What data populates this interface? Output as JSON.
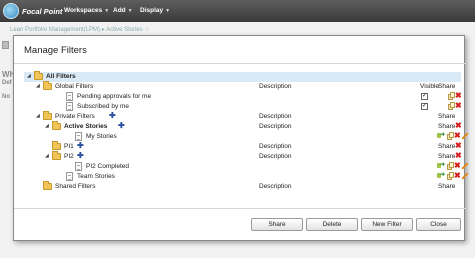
{
  "app": {
    "name": "Focal Point",
    "menus": [
      "Workspaces",
      "Add",
      "Display"
    ],
    "breadcrumb_path": "Lean Portfolio Management(LPM)",
    "breadcrumb_current": "Active Stories",
    "bg_labels": [
      "Wh",
      "Def",
      "No"
    ]
  },
  "modal": {
    "title": "Manage Filters",
    "columns": {
      "description": "Description",
      "visible": "Visible",
      "share": "Share"
    },
    "buttons": {
      "share": "Share",
      "delete": "Delete",
      "new_filter": "New Filter",
      "close": "Close"
    },
    "tree": [
      {
        "label": "All Filters",
        "level": 0,
        "kind": "folder",
        "bold": true,
        "selected": true,
        "expander": "down"
      },
      {
        "label": "Global Filters",
        "level": 1,
        "kind": "folder",
        "bold": false,
        "expander": "down",
        "description_header": true,
        "visible_header": true,
        "share_header": true
      },
      {
        "label": "Pending approvals for me",
        "level": 2,
        "kind": "doc",
        "visible_checked": true,
        "share_icons": [
          "copy",
          "delete"
        ]
      },
      {
        "label": "Subscribed by me",
        "level": 2,
        "kind": "doc",
        "visible_checked": true,
        "share_icons": [
          "copy",
          "delete"
        ]
      },
      {
        "label": "Private Filters",
        "level": 1,
        "kind": "folder",
        "expander": "down",
        "add": true,
        "description_header": true,
        "share_header": true
      },
      {
        "label": "Active Stories",
        "level": 2,
        "kind": "folder",
        "bold": true,
        "expander": "down",
        "add": true,
        "description_header": true,
        "share_header": true,
        "share_icons": [
          "delete"
        ]
      },
      {
        "label": "My Stories",
        "level": 3,
        "kind": "doc",
        "share_icons": [
          "share",
          "copy",
          "delete",
          "edit"
        ]
      },
      {
        "label": "PI1",
        "level": 2,
        "kind": "folder",
        "add": true,
        "description_header": true,
        "share_header": true,
        "share_icons": [
          "delete"
        ]
      },
      {
        "label": "PI2",
        "level": 2,
        "kind": "folder",
        "expander": "down",
        "add": true,
        "description_header": true,
        "share_header": true,
        "share_icons": [
          "delete"
        ]
      },
      {
        "label": "PI2 Completed",
        "level": 3,
        "kind": "doc",
        "share_icons": [
          "share",
          "copy",
          "delete",
          "edit"
        ]
      },
      {
        "label": "Team Stories",
        "level": 2,
        "kind": "doc",
        "share_icons": [
          "share",
          "copy",
          "delete",
          "edit"
        ]
      },
      {
        "label": "Shared Filters",
        "level": 1,
        "kind": "folder",
        "description_header": true,
        "share_header": true
      }
    ]
  }
}
